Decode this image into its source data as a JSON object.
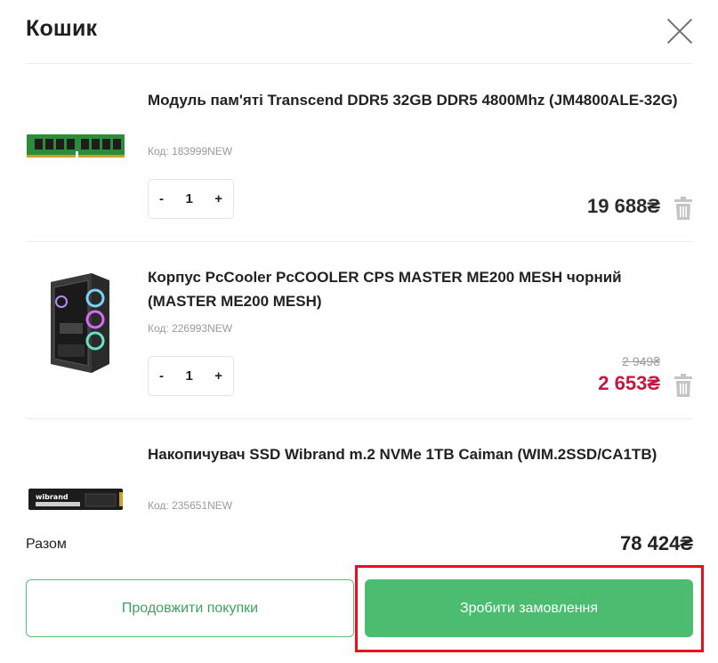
{
  "header": {
    "title": "Кошик"
  },
  "items": [
    {
      "name": "Модуль пам'яті Transcend DDR5 32GB DDR5 4800Mhz (JM4800ALE-32G)",
      "code": "Код: 183999NEW",
      "qty": "1",
      "minus": "-",
      "plus": "+",
      "price": "19 688₴",
      "old_price": ""
    },
    {
      "name": "Корпус PcCooler PcCOOLER CPS MASTER ME200 MESH чорний (MASTER ME200 MESH)",
      "code": "Код: 226993NEW",
      "qty": "1",
      "minus": "-",
      "plus": "+",
      "price": "2 653₴",
      "old_price": "2 949₴"
    },
    {
      "name": "Накопичувач SSD Wibrand m.2 NVMe 1TB Caiman (WIM.2SSD/CA1TB)",
      "code": "Код: 235651NEW"
    }
  ],
  "summary": {
    "total_label": "Разом",
    "total_value": "78 424₴"
  },
  "buttons": {
    "continue": "Продовжити покупки",
    "order": "Зробити замовлення"
  },
  "ssd_brand": "wibrand",
  "colors": {
    "accent": "#4cbd70",
    "sale": "#c5173f",
    "highlight": "#e8101a"
  }
}
